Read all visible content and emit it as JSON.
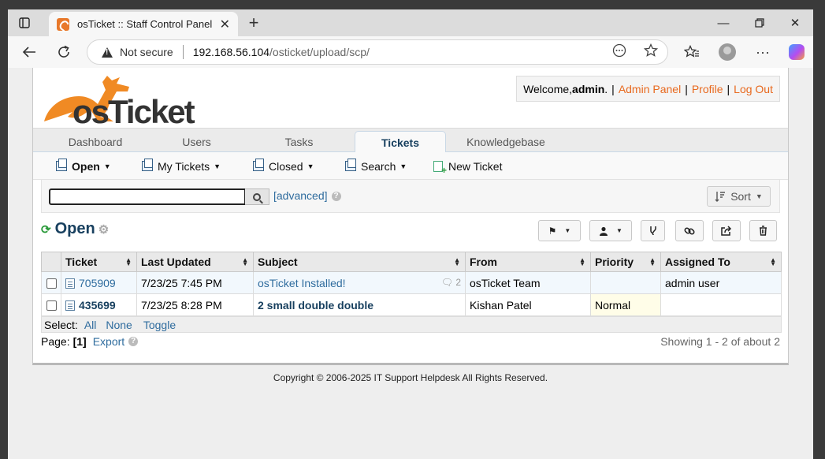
{
  "browser": {
    "tab_title": "osTicket :: Staff Control Panel",
    "not_secure": "Not secure",
    "url_host": "192.168.56.104",
    "url_path": "/osticket/upload/scp/"
  },
  "header": {
    "logo_text": "osTicket",
    "welcome": "Welcome, ",
    "username": "admin",
    "admin_panel": "Admin Panel",
    "profile": "Profile",
    "logout": "Log Out"
  },
  "nav": {
    "tabs": [
      {
        "label": "Dashboard"
      },
      {
        "label": "Users"
      },
      {
        "label": "Tasks"
      },
      {
        "label": "Tickets"
      },
      {
        "label": "Knowledgebase"
      }
    ]
  },
  "subnav": {
    "items": [
      {
        "label": "Open"
      },
      {
        "label": "My Tickets"
      },
      {
        "label": "Closed"
      },
      {
        "label": "Search"
      },
      {
        "label": "New Ticket"
      }
    ]
  },
  "search": {
    "placeholder": "",
    "advanced": "[advanced]",
    "sort": "Sort"
  },
  "queue": {
    "title": "Open"
  },
  "table": {
    "headers": [
      "Ticket",
      "Last Updated",
      "Subject",
      "From",
      "Priority",
      "Assigned To"
    ],
    "rows": [
      {
        "ticket": "705909",
        "updated": "7/23/25 7:45 PM",
        "subject": "osTicket Installed!",
        "threads": "2",
        "from": "osTicket Team",
        "priority": "",
        "assigned": "admin user"
      },
      {
        "ticket": "435699",
        "updated": "7/23/25 8:28 PM",
        "subject": "2 small double double",
        "threads": "",
        "from": "Kishan Patel",
        "priority": "Normal",
        "assigned": ""
      }
    ]
  },
  "select": {
    "label": "Select:",
    "all": "All",
    "none": "None",
    "toggle": "Toggle"
  },
  "pager": {
    "label": "Page:",
    "current": "[1]",
    "export": "Export",
    "showing": "Showing 1 - 2 of about 2"
  },
  "footer": {
    "copyright": "Copyright © 2006-2025 IT Support Helpdesk All Rights Reserved."
  }
}
